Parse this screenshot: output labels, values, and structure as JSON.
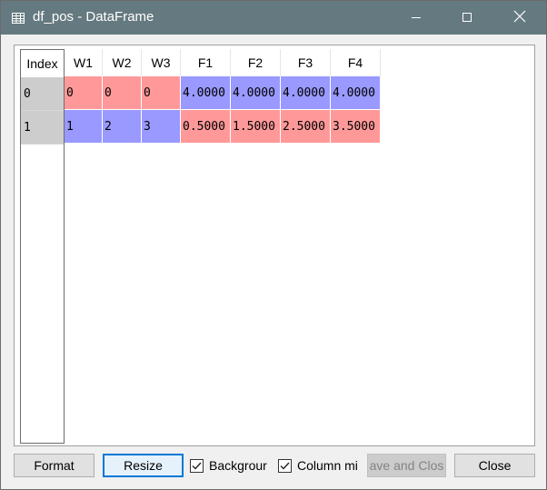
{
  "window": {
    "title": "df_pos - DataFrame",
    "icon": "table-icon",
    "controls": [
      "minimize-icon",
      "maximize-icon",
      "close-icon"
    ]
  },
  "table": {
    "index_header": "Index",
    "columns": [
      "W1",
      "W2",
      "W3",
      "F1",
      "F2",
      "F3",
      "F4"
    ],
    "index": [
      "0",
      "1"
    ],
    "rows": [
      [
        "0",
        "0",
        "0",
        "4.0000",
        "4.0000",
        "4.0000",
        "4.0000"
      ],
      [
        "1",
        "2",
        "3",
        "0.5000",
        "1.5000",
        "2.5000",
        "3.5000"
      ]
    ],
    "cell_colors": [
      [
        "red",
        "red",
        "red",
        "blue",
        "blue",
        "blue",
        "blue"
      ],
      [
        "blue",
        "blue",
        "blue",
        "red",
        "red",
        "red",
        "red"
      ]
    ],
    "colors": {
      "red": "#ff9999",
      "blue": "#9999ff",
      "index_bg": "#cdcdcd",
      "titlebar": "#657a80"
    }
  },
  "buttons": {
    "format": "Format",
    "resize": "Resize",
    "save_and_close": "ave and Clos",
    "close": "Close"
  },
  "checkboxes": {
    "background": {
      "label": "Backgrour",
      "checked": true
    },
    "column_min": {
      "label": "Column mi",
      "checked": true
    }
  }
}
